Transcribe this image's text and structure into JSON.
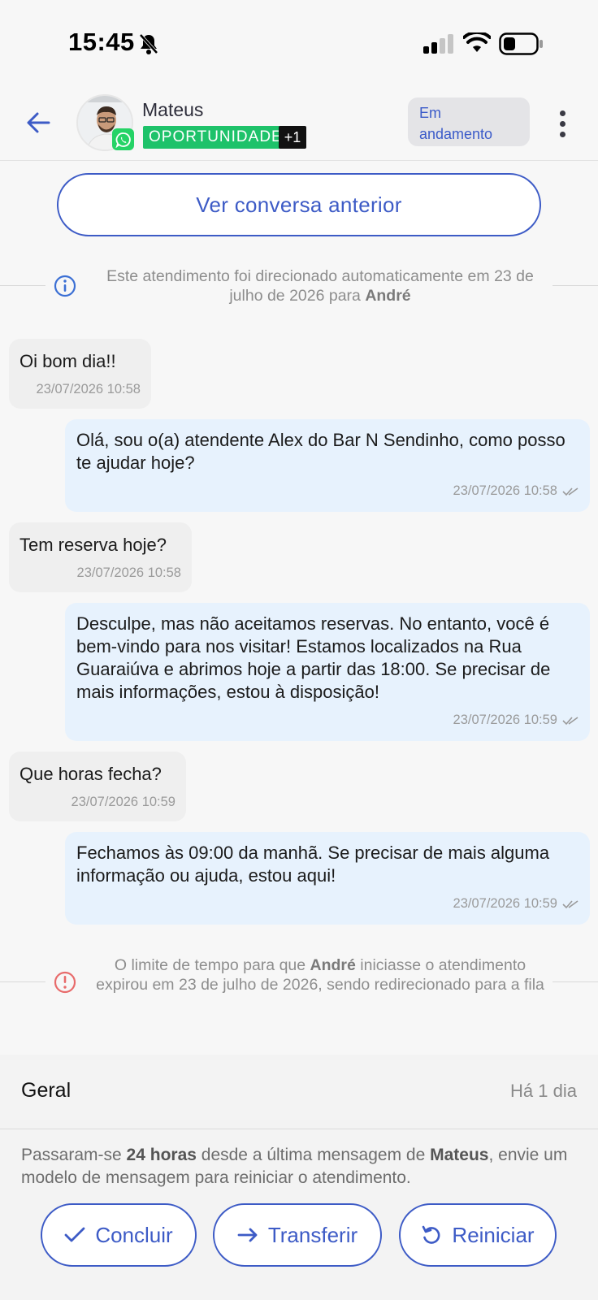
{
  "status_bar": {
    "time": "15:45"
  },
  "header": {
    "contact_name": "Mateus",
    "tag": "OPORTUNIDADE",
    "tag_extra": "+1",
    "status": "Em andamento"
  },
  "chat": {
    "prev_conversation_label": "Ver conversa anterior",
    "system_note_1": {
      "text_before": "Este atendimento foi direcionado automaticamente em 23 de julho de 2026 para ",
      "agent": "André"
    },
    "messages": [
      {
        "direction": "in",
        "text": "Oi bom dia!!",
        "time": "23/07/2026 10:58"
      },
      {
        "direction": "out",
        "text": "Olá, sou o(a) atendente Alex do Bar N Sendinho, como posso te ajudar hoje?",
        "time": "23/07/2026 10:58"
      },
      {
        "direction": "in",
        "text": "Tem reserva hoje?",
        "time": "23/07/2026 10:58"
      },
      {
        "direction": "out",
        "text": "Desculpe, mas não aceitamos reservas. No entanto, você é bem-vindo para nos visitar! Estamos localizados na Rua Guaraiúva e abrimos hoje a partir das 18:00. Se precisar de mais informações, estou à disposição!",
        "time": "23/07/2026 10:59"
      },
      {
        "direction": "in",
        "text": "Que horas fecha?",
        "time": "23/07/2026 10:59"
      },
      {
        "direction": "out",
        "text": "Fechamos às 09:00 da manhã. Se precisar de mais alguma informação ou ajuda, estou aqui!",
        "time": "23/07/2026 10:59"
      }
    ],
    "system_note_2": {
      "text_before": "O limite de tempo para que ",
      "agent": "André",
      "text_after": " iniciasse o atendimento expirou em 23 de julho de 2026, sendo redirecionado para a fila"
    }
  },
  "bottom_panel": {
    "title": "Geral",
    "time_ago": "Há 1 dia",
    "msg_before": "Passaram-se ",
    "msg_hours": "24 horas",
    "msg_middle": " desde a última mensagem de ",
    "msg_name": "Mateus",
    "msg_after": ", envie um modelo de mensagem para reiniciar o atendimento.",
    "actions": {
      "conclude": "Concluir",
      "transfer": "Transferir",
      "restart": "Reiniciar"
    }
  },
  "colors": {
    "accent": "#3d5bc6",
    "tag_green": "#1ec26a",
    "whatsapp": "#25d366",
    "out_bubble": "#e7f2fd",
    "in_bubble": "#efefef"
  }
}
